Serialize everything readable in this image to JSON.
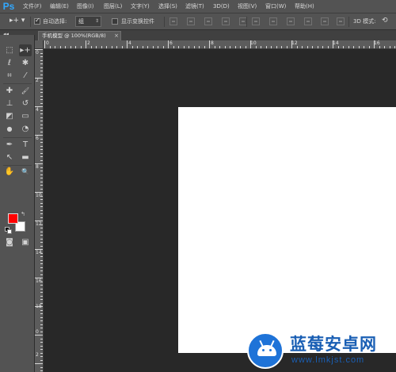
{
  "app": {
    "logo": "Ps"
  },
  "menu": [
    {
      "label": "文件(F)"
    },
    {
      "label": "编辑(E)"
    },
    {
      "label": "图像(I)"
    },
    {
      "label": "图层(L)"
    },
    {
      "label": "文字(Y)"
    },
    {
      "label": "选择(S)"
    },
    {
      "label": "滤镜(T)"
    },
    {
      "label": "3D(D)"
    },
    {
      "label": "视图(V)"
    },
    {
      "label": "窗口(W)"
    },
    {
      "label": "帮助(H)"
    }
  ],
  "options": {
    "tool_glyph": "▸+ ▾",
    "auto_select_label": "自动选择:",
    "auto_select_checked": true,
    "auto_select_value": "组",
    "show_transform_label": "显示变换控件",
    "show_transform_checked": false,
    "mode_3d_label": "3D 模式:"
  },
  "document_tab": {
    "label": "手机模型 @ 100%(RGB/8)",
    "close": "×"
  },
  "panel_collapse": "◂◂",
  "toolbox": {
    "tools": [
      {
        "name": "marquee",
        "glyph": "⬚"
      },
      {
        "name": "move",
        "glyph": "▸+"
      },
      {
        "name": "lasso",
        "glyph": "ℓ"
      },
      {
        "name": "magic-wand",
        "glyph": "✱"
      },
      {
        "name": "crop",
        "glyph": "⌗"
      },
      {
        "name": "eyedropper",
        "glyph": "⁄"
      },
      {
        "name": "healing",
        "glyph": "✚"
      },
      {
        "name": "brush",
        "glyph": "🖌"
      },
      {
        "name": "stamp",
        "glyph": "⊥"
      },
      {
        "name": "history-brush",
        "glyph": "↺"
      },
      {
        "name": "eraser",
        "glyph": "◩"
      },
      {
        "name": "gradient",
        "glyph": "▭"
      },
      {
        "name": "blur",
        "glyph": "●"
      },
      {
        "name": "dodge",
        "glyph": "◔"
      },
      {
        "name": "pen",
        "glyph": "✒"
      },
      {
        "name": "type",
        "glyph": "T"
      },
      {
        "name": "path-select",
        "glyph": "↖"
      },
      {
        "name": "shape",
        "glyph": "▬"
      },
      {
        "name": "hand",
        "glyph": "✋"
      },
      {
        "name": "zoom",
        "glyph": "🔍"
      },
      {
        "name": "quick-mask",
        "glyph": "◙"
      },
      {
        "name": "screen-mode",
        "glyph": "▣"
      }
    ],
    "foreground_color": "#ff0000",
    "background_color": "#ffffff",
    "swap_glyph": "↰"
  },
  "ruler_top": [
    "0",
    "2",
    "4",
    "6",
    "8",
    "10",
    "12",
    "14",
    "16"
  ],
  "ruler_left": [
    "0",
    "2",
    "4",
    "6",
    "8",
    "10",
    "12",
    "14",
    "16",
    "18",
    "0",
    "2",
    "4"
  ],
  "watermark": {
    "title": "蓝莓安卓网",
    "url": "www.lmkjst.com"
  },
  "colors": {
    "accent": "#31a8ff",
    "watermark_blue": "#1a5fb4",
    "foreground": "#ff0000",
    "background": "#ffffff"
  }
}
